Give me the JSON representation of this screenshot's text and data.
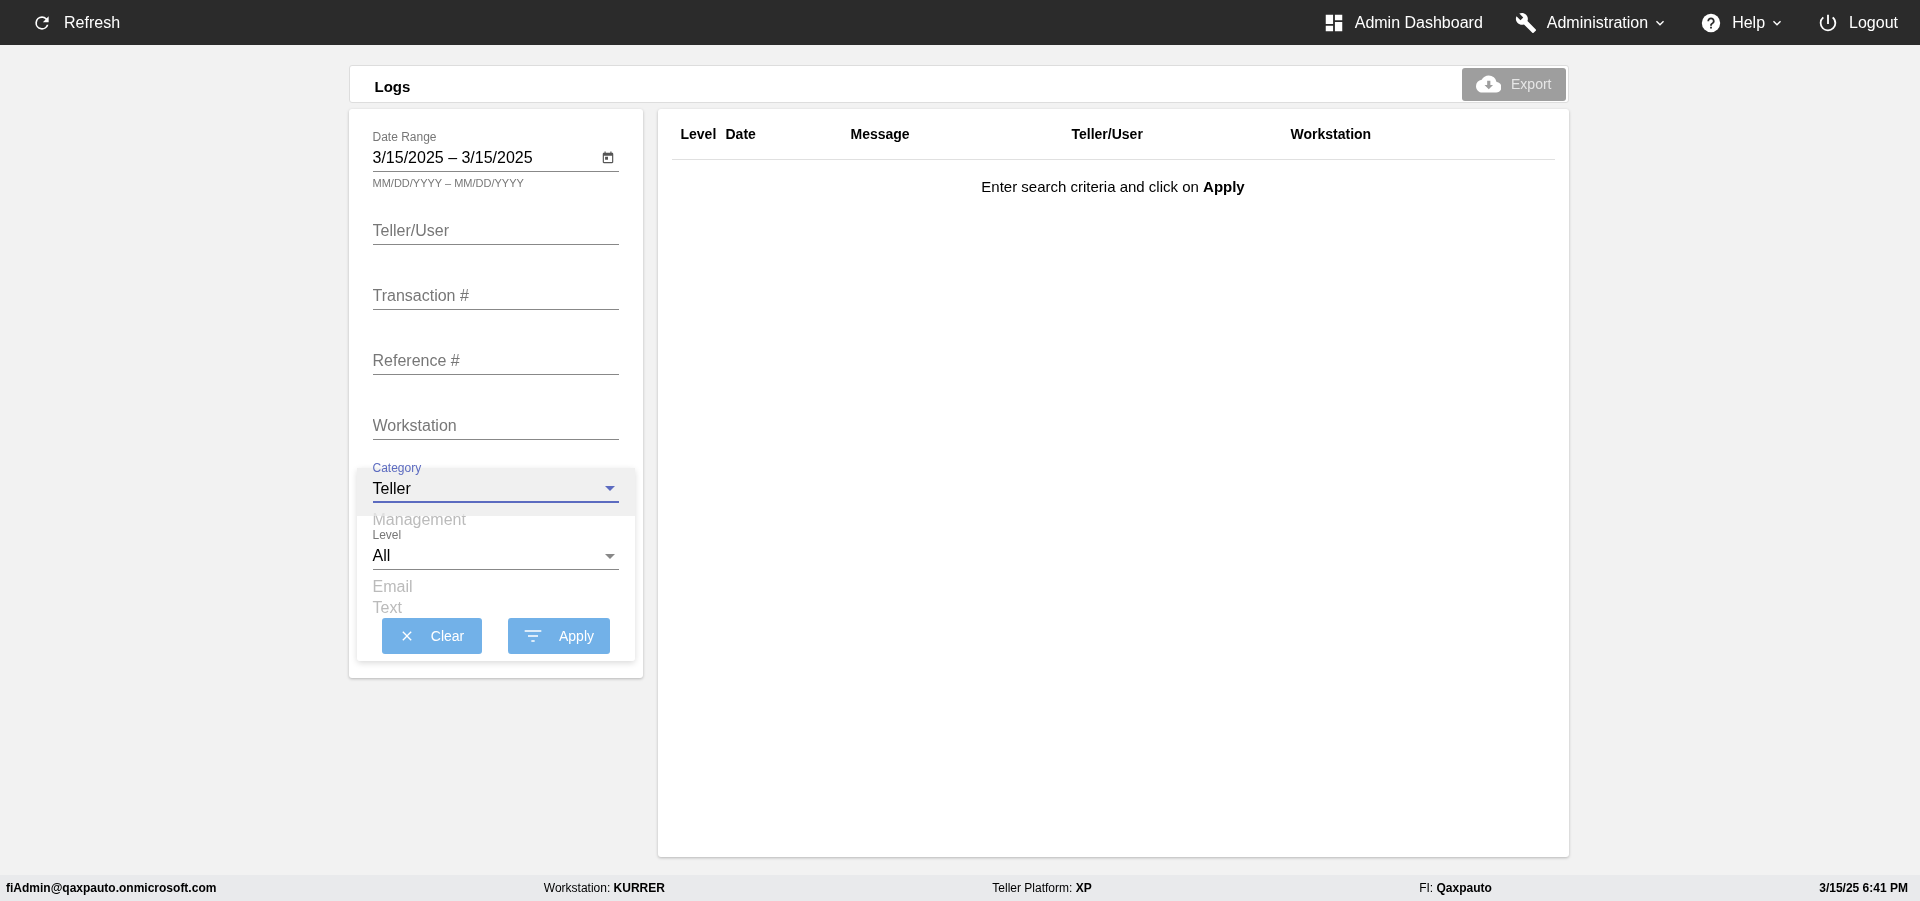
{
  "top_bar": {
    "refresh": {
      "label": "Refresh"
    },
    "nav": [
      {
        "kind": "dashboard",
        "label": "Admin Dashboard",
        "has_menu": false
      },
      {
        "kind": "wrench",
        "label": "Administration",
        "has_menu": true
      },
      {
        "kind": "help",
        "label": "Help",
        "has_menu": true
      },
      {
        "kind": "power",
        "label": "Logout",
        "has_menu": false
      }
    ]
  },
  "header": {
    "title": "Logs",
    "export": {
      "label": "Export",
      "disabled": true
    }
  },
  "filters": {
    "date_range": {
      "label": "Date Range",
      "value": "3/15/2025 – 3/15/2025",
      "hint": "MM/DD/YYYY – MM/DD/YYYY"
    },
    "text_fields": [
      {
        "placeholder": "Teller/User"
      },
      {
        "placeholder": "Transaction #"
      },
      {
        "placeholder": "Reference #"
      },
      {
        "placeholder": "Workstation"
      }
    ],
    "category": {
      "label": "Category",
      "value": "Teller",
      "expanded": true,
      "options": [
        {
          "label": "Management",
          "selected": false
        },
        {
          "label": "Email",
          "selected": false
        },
        {
          "label": "Text",
          "selected": false
        }
      ]
    },
    "level": {
      "label": "Level",
      "value": "All"
    },
    "buttons": [
      {
        "kind": "clear",
        "label": "Clear"
      },
      {
        "kind": "apply",
        "label": "Apply"
      }
    ]
  },
  "table": {
    "columns": [
      "Level",
      "Date",
      "Message",
      "Teller/User",
      "Workstation"
    ],
    "empty_message": "Enter search criteria and click on **Apply**"
  },
  "status_bar": [
    {
      "value": "fiAdmin@qaxpauto.onmicrosoft.com"
    },
    {
      "label": "Workstation: ",
      "value": "KURRER"
    },
    {
      "label": "Teller Platform: ",
      "value": "XP"
    },
    {
      "label": "FI: ",
      "value": "Qaxpauto"
    },
    {
      "value": "3/15/25 6:41 PM"
    }
  ]
}
